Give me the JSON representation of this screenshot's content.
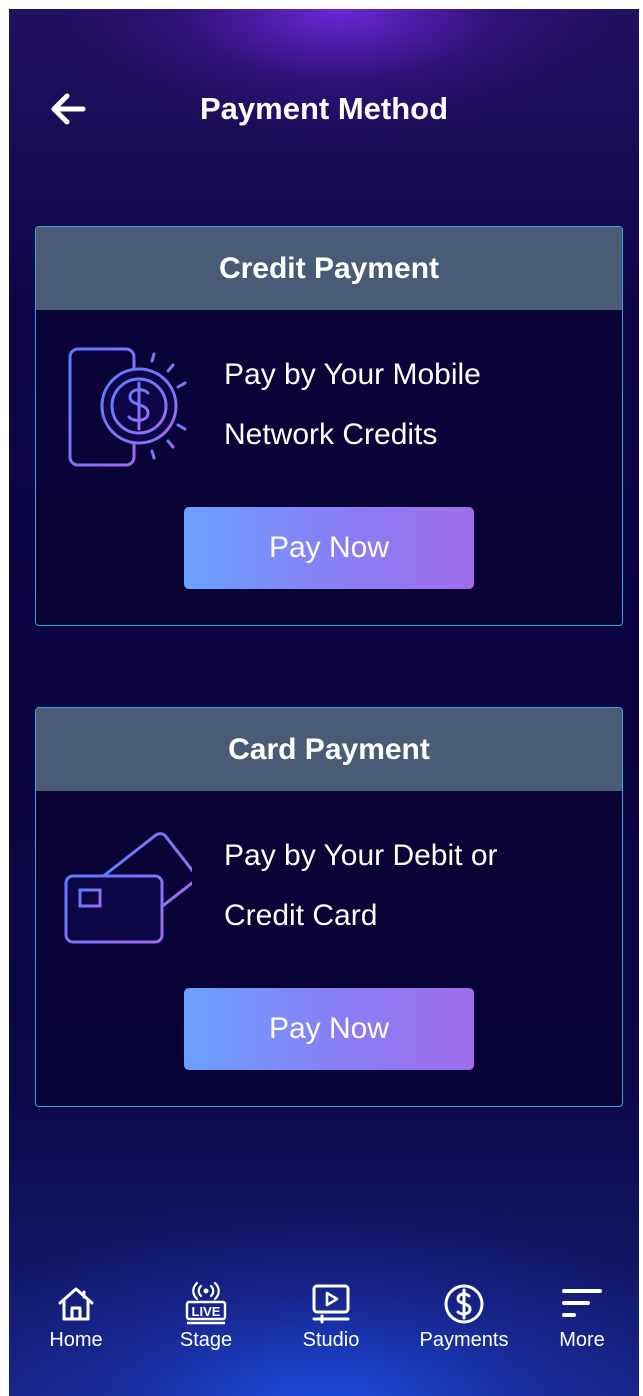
{
  "header": {
    "title": "Payment Method",
    "back_icon": "arrow-left-icon"
  },
  "cards": [
    {
      "heading": "Credit Payment",
      "icon": "mobile-dollar-icon",
      "description_line1": "Pay by Your Mobile",
      "description_line2": "Network Credits",
      "button_label": "Pay Now"
    },
    {
      "heading": "Card Payment",
      "icon": "credit-cards-icon",
      "description_line1": "Pay by Your Debit or",
      "description_line2": "Credit Card",
      "button_label": "Pay Now"
    }
  ],
  "nav": {
    "items": [
      {
        "label": "Home",
        "icon": "home-icon"
      },
      {
        "label": "Stage",
        "icon": "live-broadcast-icon",
        "badge": "LIVE"
      },
      {
        "label": "Studio",
        "icon": "video-play-icon"
      },
      {
        "label": "Payments",
        "icon": "dollar-circle-icon"
      },
      {
        "label": "More",
        "icon": "menu-lines-icon"
      }
    ]
  },
  "colors": {
    "card_header": "#4a5b77",
    "card_border": "#2fa6dc",
    "button_gradient_start": "#6ba1ff",
    "button_gradient_end": "#9f6eeb"
  }
}
